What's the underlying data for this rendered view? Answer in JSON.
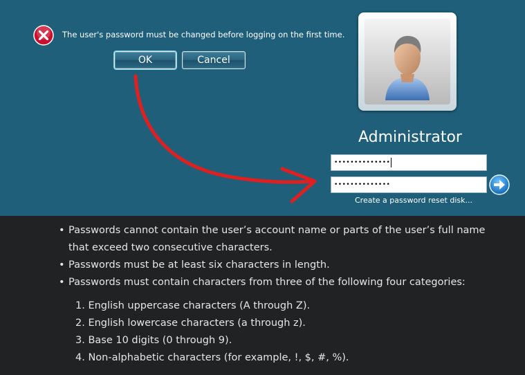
{
  "dialog": {
    "message": "The user's password must be changed before logging on the first time.",
    "ok_label": "OK",
    "cancel_label": "Cancel"
  },
  "logon": {
    "username": "Administrator",
    "new_password_value": "••••••••••••••",
    "confirm_password_value": "••••••••••••••",
    "reset_link": "Create a password reset disk..."
  },
  "rules": {
    "bullets": [
      {
        "line1": "Passwords cannot contain the user’s account name or parts of the user’s full name",
        "line2": "that exceed two consecutive characters."
      },
      {
        "line1": "Passwords must be at least six characters in length."
      },
      {
        "line1": "Passwords must contain characters from three of the following four categories:"
      }
    ],
    "categories": [
      "1. English uppercase characters (A through Z).",
      "2. English lowercase characters (a through z).",
      "3. Base 10 digits (0 through 9).",
      "4. Non-alphabetic characters (for example, !, $, #, %)."
    ]
  },
  "colors": {
    "background_top": "#1f5f7a",
    "background_bottom": "#202224",
    "annotation_arrow": "#e02020",
    "error_icon": "#c8102e"
  },
  "icons": {
    "error": "error-x-icon",
    "submit": "arrow-right-icon",
    "user": "user-avatar-icon"
  }
}
